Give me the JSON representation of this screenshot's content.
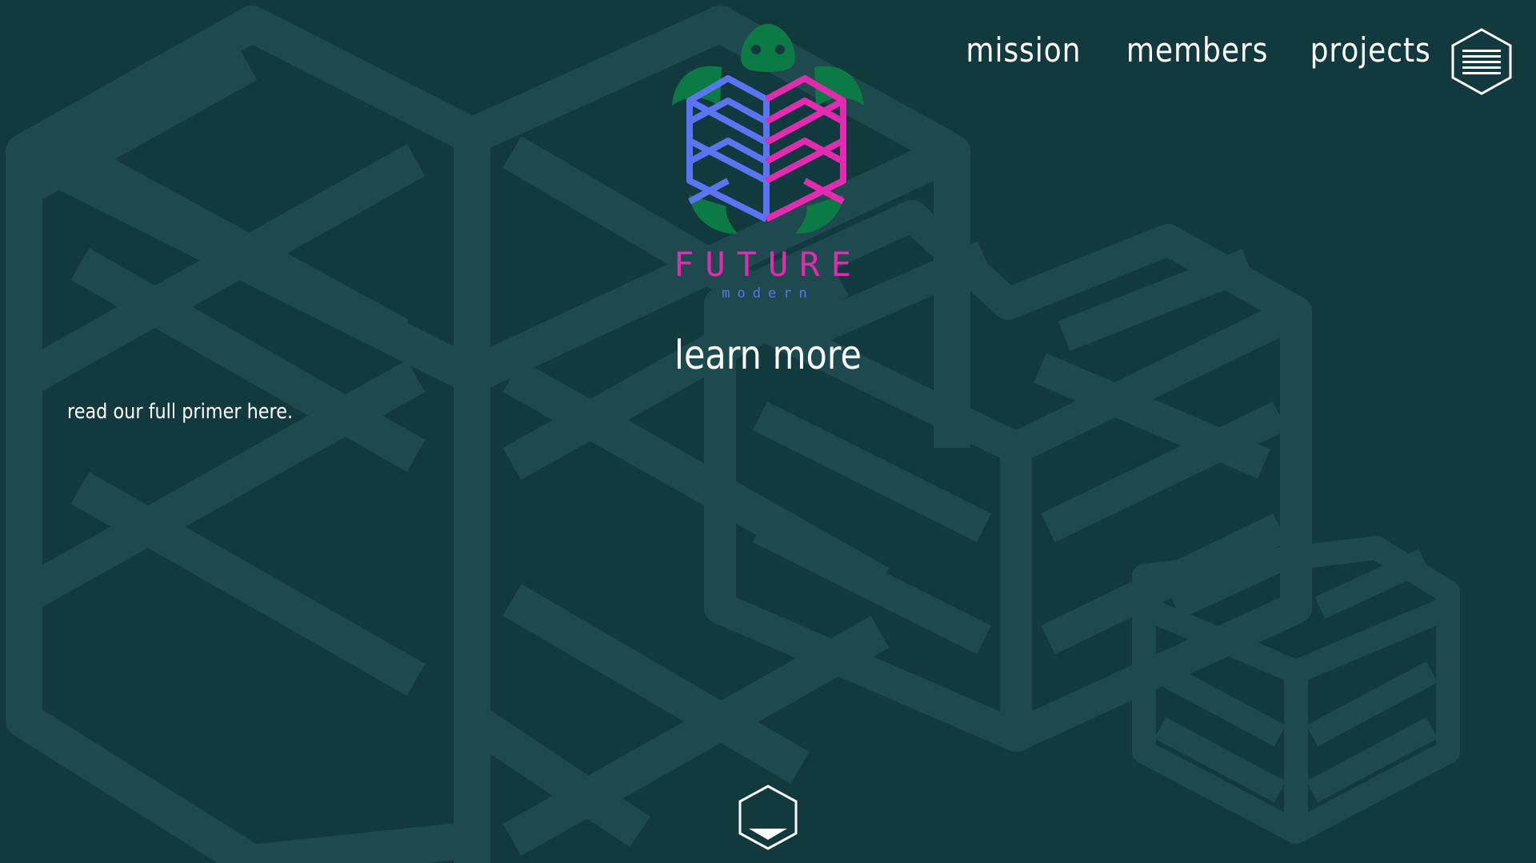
{
  "nav": {
    "items": [
      {
        "label": "mission"
      },
      {
        "label": "members"
      },
      {
        "label": "projects"
      }
    ],
    "menu_icon": "hamburger-hexagon-icon"
  },
  "brand": {
    "name": "FUTURE",
    "subtitle": "modern",
    "logo_icon": "turtle-cube-logo",
    "colors": {
      "turtle": "#0c7a45",
      "cube_left": "#5b74f1",
      "cube_right": "#e22bb0"
    }
  },
  "hero": {
    "heading": "learn more"
  },
  "content": {
    "primer_text": "read our full primer here."
  },
  "scroll": {
    "icon": "hexagon-down-arrow-icon"
  },
  "colors": {
    "background": "#123a3e",
    "pattern": "#1f4a50",
    "text": "#ffffff"
  }
}
